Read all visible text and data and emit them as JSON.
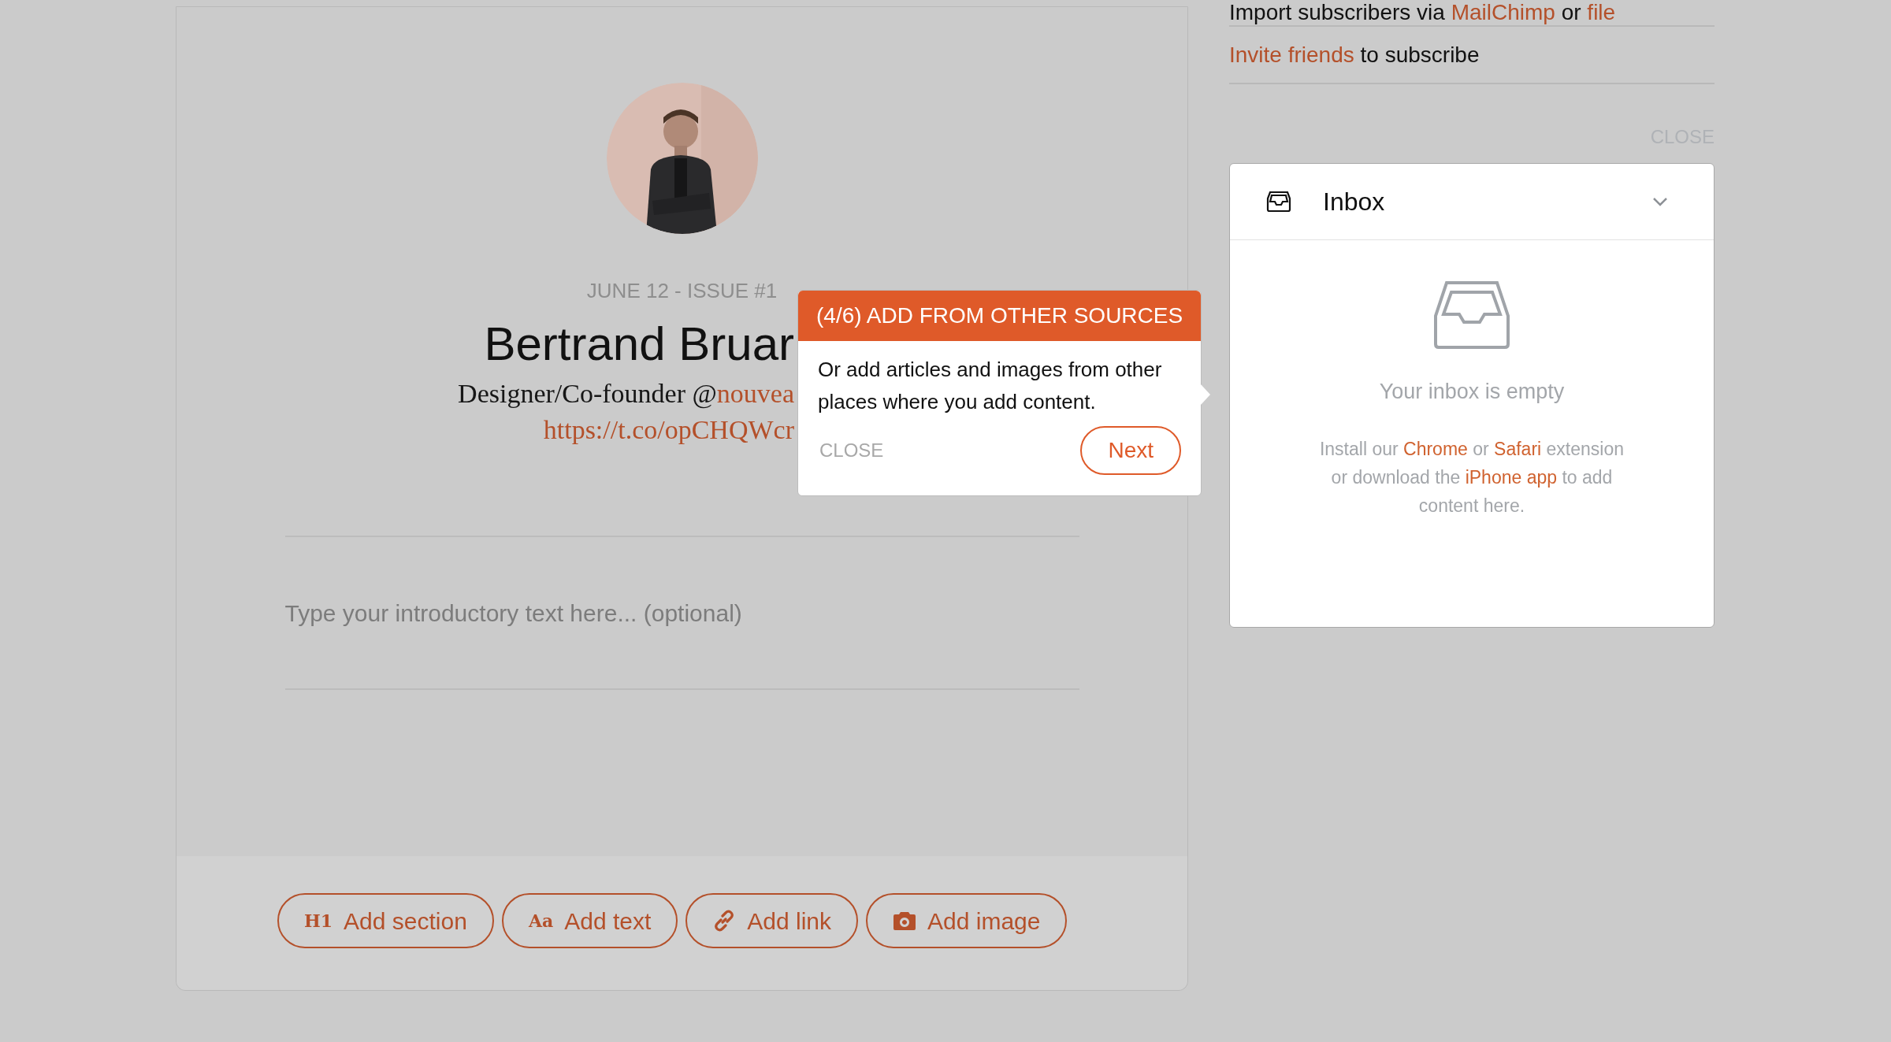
{
  "editor": {
    "issue_label": "JUNE 12 - ISSUE #1",
    "name": "Bertrand Bruar",
    "bio": [
      {
        "text": "Designer/Co-founder @",
        "link": false
      },
      {
        "text": "nouvea",
        "link": true
      }
    ],
    "bio_link": "https://t.co/opCHQWcr",
    "intro": {
      "placeholder": "Type your introductory text here... (optional)"
    },
    "toolbar": [
      {
        "kind": "glyph",
        "glyph": "H1",
        "label": "Add section"
      },
      {
        "kind": "glyph",
        "glyph": "Aa",
        "label": "Add text"
      },
      {
        "kind": "link",
        "label": "Add link"
      },
      {
        "kind": "camera",
        "label": "Add image"
      }
    ]
  },
  "tooltip": {
    "title": "(4/6) ADD FROM OTHER SOURCES",
    "body": "Or add articles and images from other places where you add content.",
    "close": "CLOSE",
    "next": "Next"
  },
  "sidebar": {
    "actions": [
      [
        {
          "text": "Import subscribers via ",
          "link": false
        },
        {
          "text": "MailChimp",
          "link": true
        },
        {
          "text": " or ",
          "link": false
        },
        {
          "text": "file",
          "link": true
        }
      ],
      [
        {
          "text": "Invite friends",
          "link": true
        },
        {
          "text": " to subscribe",
          "link": false
        }
      ]
    ],
    "close": "CLOSE",
    "inbox": {
      "title": "Inbox",
      "empty_title": "Your inbox is empty",
      "help": [
        {
          "text": "Install our ",
          "link": false
        },
        {
          "text": "Chrome",
          "link": true
        },
        {
          "text": " or ",
          "link": false
        },
        {
          "text": "Safari",
          "link": true
        },
        {
          "text": " extension or download the ",
          "link": false
        },
        {
          "text": "iPhone app",
          "link": true
        },
        {
          "text": " to add content here.",
          "link": false
        }
      ]
    }
  }
}
